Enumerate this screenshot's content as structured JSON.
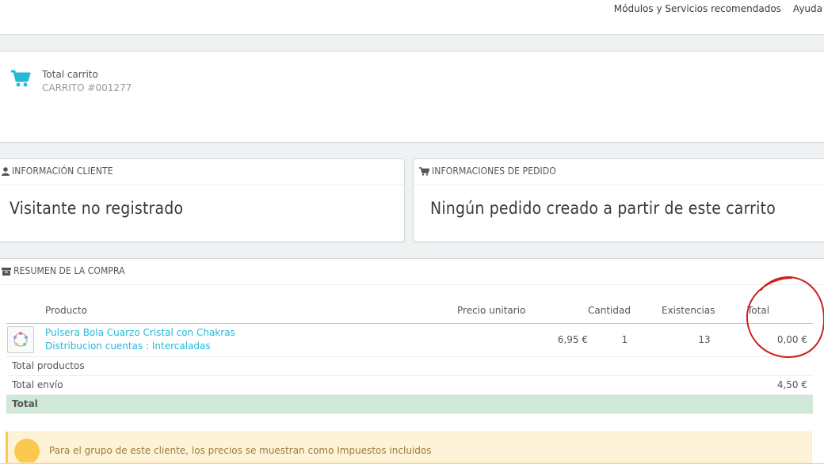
{
  "topnav": {
    "modules": "Módulos y Servicios recomendados",
    "help": "Ayuda"
  },
  "kpi": {
    "title": "Total carrito",
    "subtitle": "CARRITO #001277"
  },
  "customer": {
    "header": "INFORMACIÓN CLIENTE",
    "value": "Visitante no registrado"
  },
  "order": {
    "header": "INFORMACIONES DE PEDIDO",
    "value": "Ningún pedido creado a partir de este carrito"
  },
  "summary": {
    "header": "RESUMEN DE LA COMPRA",
    "columns": {
      "product": "Producto",
      "unit_price": "Precio unitario",
      "quantity": "Cantidad",
      "stock": "Existencias",
      "total": "Total"
    },
    "product": {
      "name": "Pulsera Bola Cuarzo Cristal con Chakras",
      "attributes": "Distribucion cuentas : Intercaladas",
      "unit_price": "6,95 €",
      "quantity": "1",
      "stock": "13",
      "total": "0,00 €"
    },
    "total_products_label": "Total productos",
    "total_shipping_label": "Total envío",
    "total_shipping_value": "4,50 €",
    "total_label": "Total"
  },
  "alert": {
    "text": "Para el grupo de este cliente, los precios se muestran como Impuestos incluidos"
  },
  "colors": {
    "accent": "#25b9d7",
    "annotation": "#cc1f1f",
    "total_row": "#cfe8d8",
    "alert_bg": "#fff3d7"
  }
}
